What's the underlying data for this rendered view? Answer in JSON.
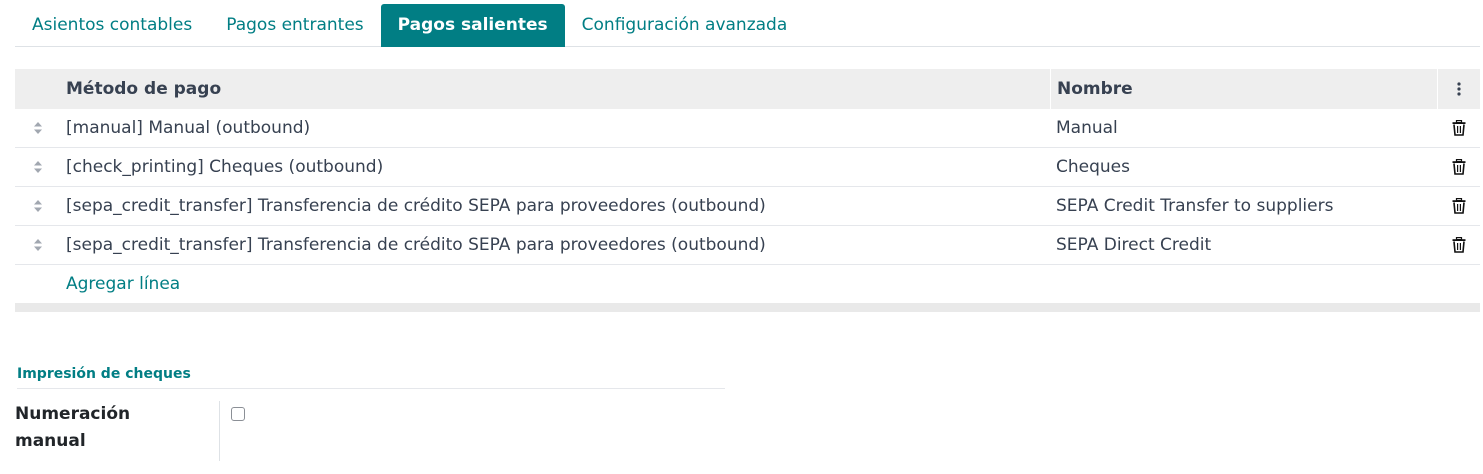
{
  "tabs": [
    {
      "label": "Asientos contables",
      "active": false
    },
    {
      "label": "Pagos entrantes",
      "active": false
    },
    {
      "label": "Pagos salientes",
      "active": true
    },
    {
      "label": "Configuración avanzada",
      "active": false
    }
  ],
  "table": {
    "headers": {
      "method": "Método de pago",
      "name": "Nombre",
      "options_icon": "kebab-vertical-icon"
    },
    "rows": [
      {
        "method": "[manual] Manual (outbound)",
        "name": "Manual"
      },
      {
        "method": "[check_printing] Cheques (outbound)",
        "name": "Cheques"
      },
      {
        "method": "[sepa_credit_transfer] Transferencia de crédito SEPA para proveedores (outbound)",
        "name": "SEPA Credit Transfer to suppliers"
      },
      {
        "method": "[sepa_credit_transfer] Transferencia de crédito SEPA para proveedores (outbound)",
        "name": "SEPA Direct Credit"
      }
    ],
    "row_icons": {
      "handle": "drag-handle-icon",
      "delete": "trash-icon"
    },
    "add_line": "Agregar línea"
  },
  "section": {
    "title": "Impresión de cheques",
    "field_label": "Numeración manual",
    "field_checked": false
  },
  "colors": {
    "accent": "#017e84",
    "header_bg": "#eeeeee",
    "text": "#374151"
  }
}
